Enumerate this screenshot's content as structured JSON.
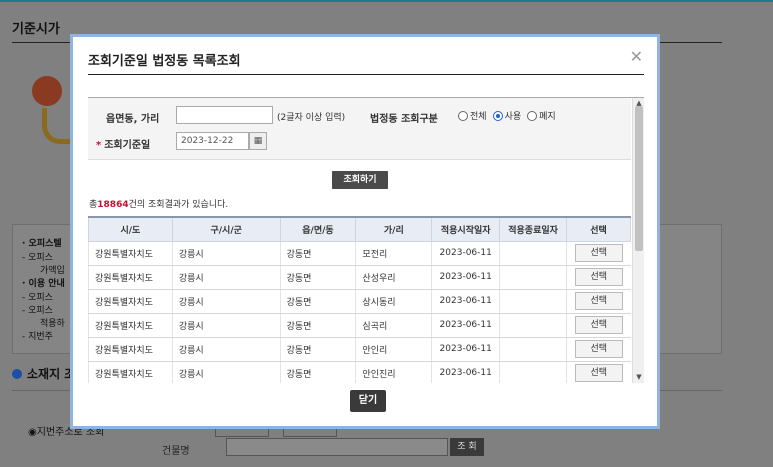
{
  "background": {
    "page_title": "기준시가",
    "list_items": [
      "· 오피스텔",
      "- 오피스",
      "가액입",
      "· 이용 안내",
      "- 오피스",
      "- 오피스",
      "적용하",
      "- 지번주"
    ],
    "section_title": "소재지 조회",
    "radio_label": "◉지번주소로 조회",
    "building_label": "건물명",
    "building_search_button": "조 회"
  },
  "modal": {
    "title": "조회기준일 법정동 목록조회",
    "close_icon": "close-icon",
    "search": {
      "town_label": "읍면동, 가리",
      "town_value": "",
      "town_hint": "(2글자 이상 입력)",
      "division_label": "법정동 조회구분",
      "division_options": [
        {
          "label": "전체",
          "selected": false
        },
        {
          "label": "사용",
          "selected": true
        },
        {
          "label": "폐지",
          "selected": false
        }
      ],
      "date_label": "조회기준일",
      "date_value": "2023-12-22"
    },
    "search_button": "조회하기",
    "result_count_prefix": "총",
    "result_count": "18864",
    "result_count_suffix": "건의 조회결과가 있습니다.",
    "table": {
      "headers": [
        "시/도",
        "구/시/군",
        "읍/면/동",
        "가/리",
        "적용시작일자",
        "적용종료일자",
        "선택"
      ],
      "select_label": "선택",
      "rows": [
        [
          "강원특별자치도",
          "강릉시",
          "강동면",
          "모전리",
          "2023-06-11",
          ""
        ],
        [
          "강원특별자치도",
          "강릉시",
          "강동면",
          "산성우리",
          "2023-06-11",
          ""
        ],
        [
          "강원특별자치도",
          "강릉시",
          "강동면",
          "상시동리",
          "2023-06-11",
          ""
        ],
        [
          "강원특별자치도",
          "강릉시",
          "강동면",
          "심곡리",
          "2023-06-11",
          ""
        ],
        [
          "강원특별자치도",
          "강릉시",
          "강동면",
          "안인리",
          "2023-06-11",
          ""
        ],
        [
          "강원특별자치도",
          "강릉시",
          "강동면",
          "안인진리",
          "2023-06-11",
          ""
        ]
      ]
    },
    "close_button": "닫기"
  },
  "colors": {
    "accent": "#1f5fd6",
    "count_highlight": "#c8102e",
    "modal_border": "#8fb4e0"
  }
}
